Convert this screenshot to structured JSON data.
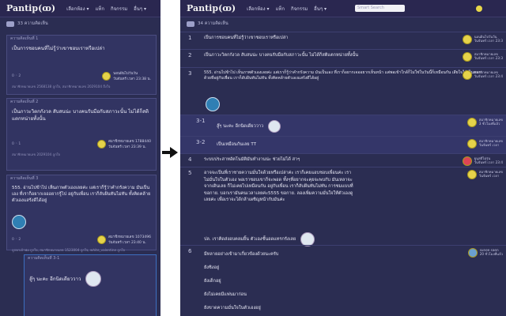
{
  "nav": {
    "logo": "Pantip",
    "logo_mark": "(ꝏ)",
    "menu": [
      "เลือกห้อง ▾",
      "แท็ก",
      "กิจกรรม",
      "อื่นๆ ▾"
    ],
    "search_placeholder": "Smart Search"
  },
  "left": {
    "count_label": "33 ความคิดเห็น",
    "cards": [
      {
        "header": "ความคิดเห็นที่ 1",
        "body": "เป็นการชอบคนที่ไม่รู้ว่าเขาชอบเราหรือเปล่า",
        "votes": "0 ◦ 2",
        "user": "นอนฝันไปวันวัน",
        "time": "วันจันทร์ เวลา 23:38 น.",
        "footer": "สมาชิกหมายเลข 2568138 ถูกใจ, สมาชิกหมายเลข 2029104 ถึงใจ"
      },
      {
        "header": "ความคิดเห็นที่ 2",
        "body": "เป็นภาวะวิตกกังวล สับสนน่ะ บางคนรับมือกับสภาวะนั้น ไม่ได้ก็สติแตกหน่ายทั้งนั้น",
        "votes": "0 ◦ 1",
        "user": "สมาชิกหมายเลข 1788440",
        "time": "วันจันทร์ เวลา 23:39 น.",
        "footer": "สมาชิกหมายเลข 2029104 ถูกใจ"
      },
      {
        "header": "ความคิดเห็นที่ 3",
        "body": "555. อ่านไปข้าไป เห็นภาพตัวเองเลยค่ะ แต่เราก็รู้ว่าคำกรังความ มันเป็นเอง ที่เราก็อยากเจออยากรู้ไป อยู่กับเพื่อน เราก็ลับฝ้นทันไม่ทัน ทั้งคิดคล้ายตัวเองแสร้งดีได้อยู่",
        "votes": "0 ◦ 2",
        "user": "สมาชิกหมายเลข 1073496",
        "time": "วันจันทร์ เวลา 23:40 น.",
        "footer": "ลูกหาเจ้าพ่อ ถูกใจ, สมาชิกหมายเลข 1523004 ถูกใจ, white_valentine ถูกใจ"
      },
      {
        "header": "ความคิดเห็นที่ 3-1",
        "body": "ลู๊ๆ นะคะ อีกนิดเดียววาว",
        "votes": "",
        "user": "",
        "time": "",
        "footer": ""
      }
    ]
  },
  "right": {
    "count_label": "34 ความคิดเห็น",
    "rows": [
      {
        "num": "1",
        "text": "เป็นการชอบคนที่ไม่รู้ว่าเขาชอบเราหรือเปล่า",
        "user": "นอนฝันไปวันวัน",
        "time": "วันจันทร์ เวลา 23:3"
      },
      {
        "num": "2",
        "text": "เป็นภาวะวิตกกังวล สับสนน่ะ บางคนรับมือกับสภาวะนั้น ไม่ได้ก็สติแตกหน่ายทั้งนั้น",
        "user": "สมาชิกหมายเลข",
        "time": "วันจันทร์ เวลา 23:3"
      },
      {
        "num": "3",
        "text": "555. อ่านไปข้าไป เห็นภาพตัวเองเลยค่ะ แต่เราก็รู้ว่าคำกรังความ มันเป็นเอง ที่เราก็อยากเจออยากเห็นหน้า แต่พอเข้าใกล้ก็ไม่ใช่ในวันนี้ก็เหมือนกัน เสียใจใด้เป็นตลกด้วยที่อยู่กับเพื่อน เราก็ลับฝ้นทันไม่ทัน ทั้งคิดคล้ายตัวเองแสร้งดีได้อยู่",
        "user": "สมาชิกหมายเลข",
        "time": "วันจันทร์ เวลา 23:4"
      },
      {
        "num": "3-1",
        "text": "ลู๊ๆ นะคะ อีกนิดเดียววาว",
        "user": "สมาชิกหมายเลข",
        "time": "3 ชั่วโมงที่แล้ว"
      },
      {
        "num": "3-2",
        "text": "เป็นเหมือนกันเลย TT",
        "user": "สมาชิกหมายเลข",
        "time": "วันจันทร์ เวลา"
      },
      {
        "num": "4",
        "text": "ระบบประสาทอัตโนมัติมันทำงานน่ะ ช่วยไม่ได้ สาๆ",
        "user": "ยูนุสดีไม่รุ่น",
        "time": "วันจันทร์ เวลา 23:4"
      },
      {
        "num": "5",
        "text": "อาจจะเป็นที่เราชายความมั่นใจด้วยหรือเปล่าค่ะ เราก็เคยแอบชอบเพื่อนค่ะ เราไม่มั่นใจในตัวเอง พอเราชอบเขาก็จะพอด ทั้งๆที่อยากจะคุยจะพบกับ มันเหลาจะจากเดินเลย ก็ไม่เคยไปเหมือนกัน อยู่กับเพื่อน เราก็ลับฝ้นทันไม่ทัน การชมแบบที่ ขอกาย. บอกเรามันคนเวลาเลยค่ะ5555 ขอกาย. ลองเพิ่มความมั่นใจให้ตัวเองดูเลยค่ะ เพื่อเราจะได้กล้าเผชิญหน้ากับมันค่ะ",
        "user": "สมาชิกหมายเลข",
        "time": "วันจันทร์ เวลา"
      },
      {
        "num": "",
        "text": "ปล. เราคิดส่งอบคลมยิ้น ตัวเองชั้นอดแทรกรังเลย",
        "user": "",
        "time": ""
      },
      {
        "num": "6",
        "text": "มีหลายอย่างเข้ามาเกี่ยวข้องด้วยนะครับ",
        "user": "sunee saen",
        "time": "20 ชั่วโมงที่แล้ว"
      },
      {
        "num": "",
        "text": "ยังซิงอยู่",
        "user": "",
        "time": ""
      },
      {
        "num": "",
        "text": "ยังเด็กอยู่",
        "user": "",
        "time": ""
      },
      {
        "num": "",
        "text": "ยังไม่เคยมีแฟนมาก่อน",
        "user": "",
        "time": ""
      },
      {
        "num": "",
        "text": "ยังขาดความมั่นใจในตัวเองอยู่",
        "user": "",
        "time": ""
      }
    ]
  }
}
